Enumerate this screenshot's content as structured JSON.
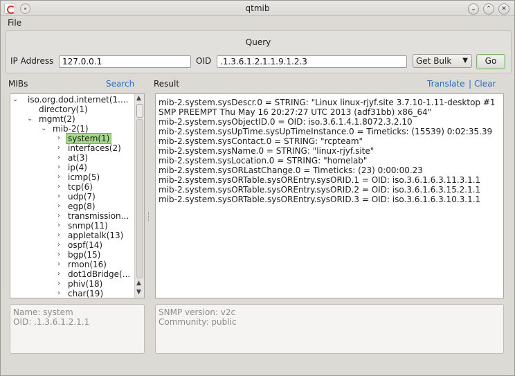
{
  "window": {
    "title": "qtmib"
  },
  "menubar": {
    "file": "File"
  },
  "query": {
    "title": "Query",
    "ip_label": "IP Address",
    "ip_value": "127.0.0.1",
    "oid_label": "OID",
    "oid_value": ".1.3.6.1.2.1.1.9.1.2.3",
    "method": "Get Bulk",
    "go_label": "Go"
  },
  "mibs": {
    "label": "MIBs",
    "search_label": "Search",
    "tree": [
      {
        "label": "iso.org.dod.internet(1....",
        "expanded": true
      },
      {
        "label": "directory(1)"
      },
      {
        "label": "mgmt(2)",
        "expanded": true
      },
      {
        "label": "mib-2(1)",
        "expanded": true
      },
      {
        "label": "system(1)",
        "selected": true
      },
      {
        "label": "interfaces(2)"
      },
      {
        "label": "at(3)"
      },
      {
        "label": "ip(4)"
      },
      {
        "label": "icmp(5)"
      },
      {
        "label": "tcp(6)"
      },
      {
        "label": "udp(7)"
      },
      {
        "label": "egp(8)"
      },
      {
        "label": "transmission..."
      },
      {
        "label": "snmp(11)"
      },
      {
        "label": "appletalk(13)"
      },
      {
        "label": "ospf(14)"
      },
      {
        "label": "bgp(15)"
      },
      {
        "label": "rmon(16)"
      },
      {
        "label": "dot1dBridge(..."
      },
      {
        "label": "phiv(18)"
      },
      {
        "label": "char(19)"
      }
    ]
  },
  "result": {
    "label": "Result",
    "translate_label": "Translate",
    "separator": "|",
    "clear_label": "Clear",
    "lines": [
      "mib-2.system.sysDescr.0 = STRING: \"Linux linux-rjyf.site 3.7.10-1.11-desktop #1",
      "SMP PREEMPT Thu May 16 20:27:27 UTC 2013 (adf31bb) x86_64\"",
      "mib-2.system.sysObjectID.0 = OID: iso.3.6.1.4.1.8072.3.2.10",
      "mib-2.system.sysUpTime.sysUpTimeInstance.0 = Timeticks: (15539) 0:02:35.39",
      "mib-2.system.sysContact.0 = STRING: \"rcpteam\"",
      "mib-2.system.sysName.0 = STRING: \"linux-rjyf.site\"",
      "mib-2.system.sysLocation.0 = STRING: \"homelab\"",
      "mib-2.system.sysORLastChange.0 = Timeticks: (23) 0:00:00.23",
      "mib-2.system.sysORTable.sysOREntry.sysORID.1 = OID: iso.3.6.1.6.3.11.3.1.1",
      "mib-2.system.sysORTable.sysOREntry.sysORID.2 = OID: iso.3.6.1.6.3.15.2.1.1",
      "mib-2.system.sysORTable.sysOREntry.sysORID.3 = OID: iso.3.6.1.6.3.10.3.1.1"
    ]
  },
  "mib_info": {
    "name": "Name: system",
    "oid": "OID: .1.3.6.1.2.1.1"
  },
  "session_info": {
    "version": "SNMP version: v2c",
    "community": "Community: public"
  },
  "colors": {
    "link": "#2a6dbf",
    "selection": "#a7d88e",
    "go_border": "#7fae6f"
  }
}
